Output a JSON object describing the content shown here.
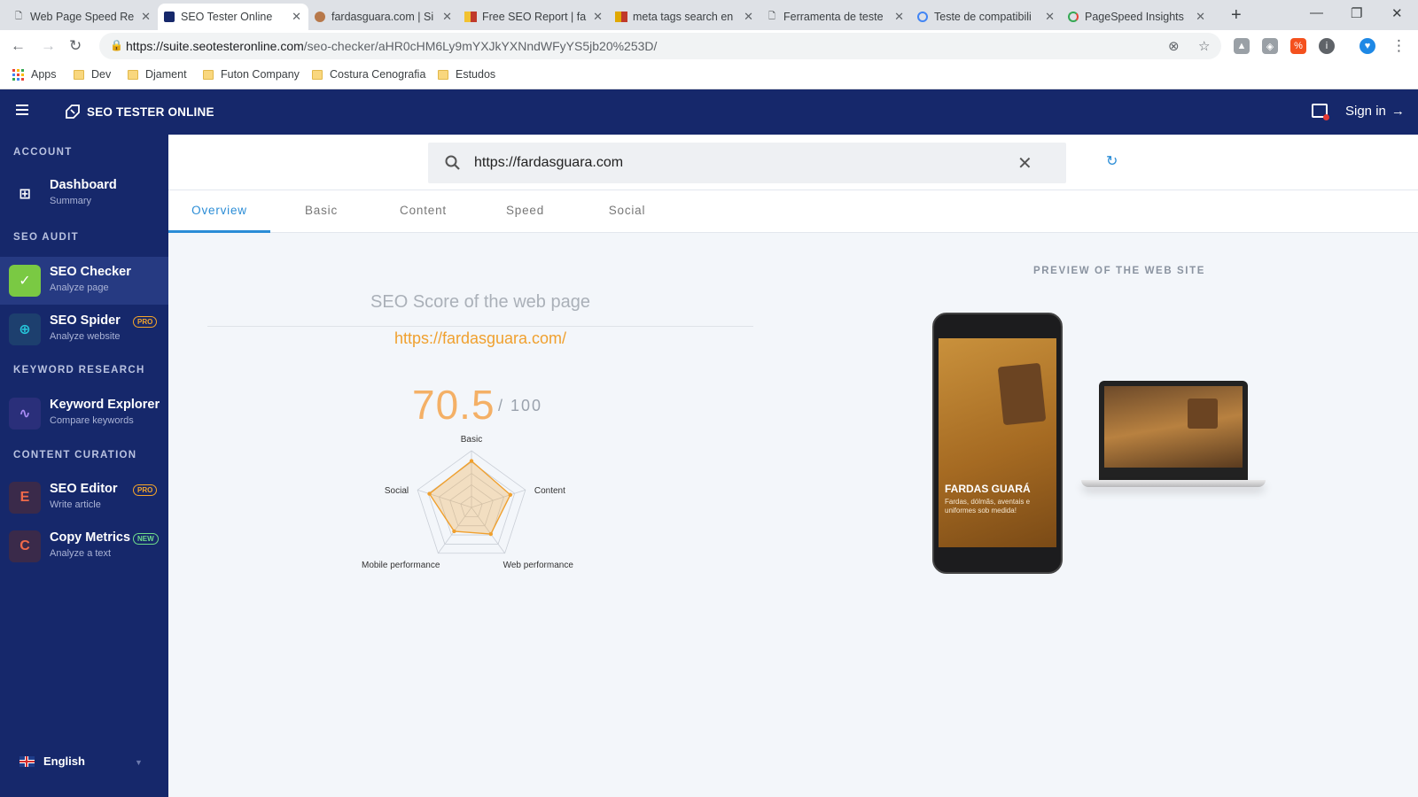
{
  "browser": {
    "tabs": [
      {
        "title": "Web Page Speed Re"
      },
      {
        "title": "SEO Tester Online"
      },
      {
        "title": "fardasguara.com | Si"
      },
      {
        "title": "Free SEO Report | fa"
      },
      {
        "title": "meta tags search en"
      },
      {
        "title": "Ferramenta de teste"
      },
      {
        "title": "Teste de compatibili"
      },
      {
        "title": "PageSpeed Insights"
      }
    ],
    "url_host": "https://suite.seotesteronline.com",
    "url_path": "/seo-checker/aHR0cHM6Ly9mYXJkYXNndWFyYS5jb20%253D/",
    "bookmarks": [
      "Apps",
      "Dev",
      "Djament",
      "Futon Company",
      "Costura Cenografia",
      "Estudos"
    ]
  },
  "header": {
    "brand": "SEO TESTER ONLINE",
    "signin": "Sign in"
  },
  "sidebar": {
    "sections": [
      {
        "title": "ACCOUNT"
      },
      {
        "title": "SEO AUDIT"
      },
      {
        "title": "KEYWORD RESEARCH"
      },
      {
        "title": "CONTENT CURATION"
      }
    ],
    "items": [
      {
        "label": "Dashboard",
        "sub": "Summary"
      },
      {
        "label": "SEO Checker",
        "sub": "Analyze page"
      },
      {
        "label": "SEO Spider",
        "sub": "Analyze website",
        "badge": "PRO"
      },
      {
        "label": "Keyword Explorer",
        "sub": "Compare keywords"
      },
      {
        "label": "SEO Editor",
        "sub": "Write article",
        "badge": "PRO"
      },
      {
        "label": "Copy Metrics",
        "sub": "Analyze a text",
        "badge": "NEW"
      }
    ],
    "language": "English"
  },
  "search": {
    "value": "https://fardasguara.com"
  },
  "tabs": [
    "Overview",
    "Basic",
    "Content",
    "Speed",
    "Social"
  ],
  "score": {
    "title": "SEO Score of the web page",
    "url": "https://fardasguara.com/",
    "value": "70.5",
    "max": "/ 100"
  },
  "radar": {
    "axes": [
      "Basic",
      "Content",
      "Web performance",
      "Mobile performance",
      "Social"
    ],
    "values": [
      0.82,
      0.72,
      0.58,
      0.52,
      0.78
    ],
    "color": "#f0a02e"
  },
  "preview": {
    "title": "PREVIEW OF THE WEB SITE",
    "site_name": "FARDAS GUARÁ",
    "site_tagline": "Fardas, dólmãs, aventais e uniformes sob medida!"
  }
}
